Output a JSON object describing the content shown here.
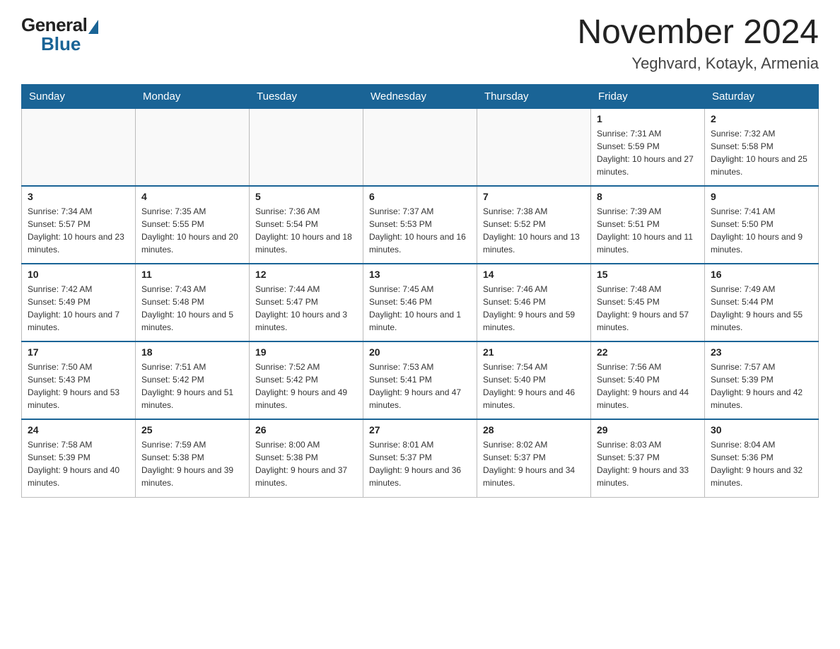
{
  "logo": {
    "general": "General",
    "blue": "Blue"
  },
  "title": "November 2024",
  "subtitle": "Yeghvard, Kotayk, Armenia",
  "weekdays": [
    "Sunday",
    "Monday",
    "Tuesday",
    "Wednesday",
    "Thursday",
    "Friday",
    "Saturday"
  ],
  "weeks": [
    [
      {
        "day": "",
        "info": ""
      },
      {
        "day": "",
        "info": ""
      },
      {
        "day": "",
        "info": ""
      },
      {
        "day": "",
        "info": ""
      },
      {
        "day": "",
        "info": ""
      },
      {
        "day": "1",
        "info": "Sunrise: 7:31 AM\nSunset: 5:59 PM\nDaylight: 10 hours and 27 minutes."
      },
      {
        "day": "2",
        "info": "Sunrise: 7:32 AM\nSunset: 5:58 PM\nDaylight: 10 hours and 25 minutes."
      }
    ],
    [
      {
        "day": "3",
        "info": "Sunrise: 7:34 AM\nSunset: 5:57 PM\nDaylight: 10 hours and 23 minutes."
      },
      {
        "day": "4",
        "info": "Sunrise: 7:35 AM\nSunset: 5:55 PM\nDaylight: 10 hours and 20 minutes."
      },
      {
        "day": "5",
        "info": "Sunrise: 7:36 AM\nSunset: 5:54 PM\nDaylight: 10 hours and 18 minutes."
      },
      {
        "day": "6",
        "info": "Sunrise: 7:37 AM\nSunset: 5:53 PM\nDaylight: 10 hours and 16 minutes."
      },
      {
        "day": "7",
        "info": "Sunrise: 7:38 AM\nSunset: 5:52 PM\nDaylight: 10 hours and 13 minutes."
      },
      {
        "day": "8",
        "info": "Sunrise: 7:39 AM\nSunset: 5:51 PM\nDaylight: 10 hours and 11 minutes."
      },
      {
        "day": "9",
        "info": "Sunrise: 7:41 AM\nSunset: 5:50 PM\nDaylight: 10 hours and 9 minutes."
      }
    ],
    [
      {
        "day": "10",
        "info": "Sunrise: 7:42 AM\nSunset: 5:49 PM\nDaylight: 10 hours and 7 minutes."
      },
      {
        "day": "11",
        "info": "Sunrise: 7:43 AM\nSunset: 5:48 PM\nDaylight: 10 hours and 5 minutes."
      },
      {
        "day": "12",
        "info": "Sunrise: 7:44 AM\nSunset: 5:47 PM\nDaylight: 10 hours and 3 minutes."
      },
      {
        "day": "13",
        "info": "Sunrise: 7:45 AM\nSunset: 5:46 PM\nDaylight: 10 hours and 1 minute."
      },
      {
        "day": "14",
        "info": "Sunrise: 7:46 AM\nSunset: 5:46 PM\nDaylight: 9 hours and 59 minutes."
      },
      {
        "day": "15",
        "info": "Sunrise: 7:48 AM\nSunset: 5:45 PM\nDaylight: 9 hours and 57 minutes."
      },
      {
        "day": "16",
        "info": "Sunrise: 7:49 AM\nSunset: 5:44 PM\nDaylight: 9 hours and 55 minutes."
      }
    ],
    [
      {
        "day": "17",
        "info": "Sunrise: 7:50 AM\nSunset: 5:43 PM\nDaylight: 9 hours and 53 minutes."
      },
      {
        "day": "18",
        "info": "Sunrise: 7:51 AM\nSunset: 5:42 PM\nDaylight: 9 hours and 51 minutes."
      },
      {
        "day": "19",
        "info": "Sunrise: 7:52 AM\nSunset: 5:42 PM\nDaylight: 9 hours and 49 minutes."
      },
      {
        "day": "20",
        "info": "Sunrise: 7:53 AM\nSunset: 5:41 PM\nDaylight: 9 hours and 47 minutes."
      },
      {
        "day": "21",
        "info": "Sunrise: 7:54 AM\nSunset: 5:40 PM\nDaylight: 9 hours and 46 minutes."
      },
      {
        "day": "22",
        "info": "Sunrise: 7:56 AM\nSunset: 5:40 PM\nDaylight: 9 hours and 44 minutes."
      },
      {
        "day": "23",
        "info": "Sunrise: 7:57 AM\nSunset: 5:39 PM\nDaylight: 9 hours and 42 minutes."
      }
    ],
    [
      {
        "day": "24",
        "info": "Sunrise: 7:58 AM\nSunset: 5:39 PM\nDaylight: 9 hours and 40 minutes."
      },
      {
        "day": "25",
        "info": "Sunrise: 7:59 AM\nSunset: 5:38 PM\nDaylight: 9 hours and 39 minutes."
      },
      {
        "day": "26",
        "info": "Sunrise: 8:00 AM\nSunset: 5:38 PM\nDaylight: 9 hours and 37 minutes."
      },
      {
        "day": "27",
        "info": "Sunrise: 8:01 AM\nSunset: 5:37 PM\nDaylight: 9 hours and 36 minutes."
      },
      {
        "day": "28",
        "info": "Sunrise: 8:02 AM\nSunset: 5:37 PM\nDaylight: 9 hours and 34 minutes."
      },
      {
        "day": "29",
        "info": "Sunrise: 8:03 AM\nSunset: 5:37 PM\nDaylight: 9 hours and 33 minutes."
      },
      {
        "day": "30",
        "info": "Sunrise: 8:04 AM\nSunset: 5:36 PM\nDaylight: 9 hours and 32 minutes."
      }
    ]
  ]
}
